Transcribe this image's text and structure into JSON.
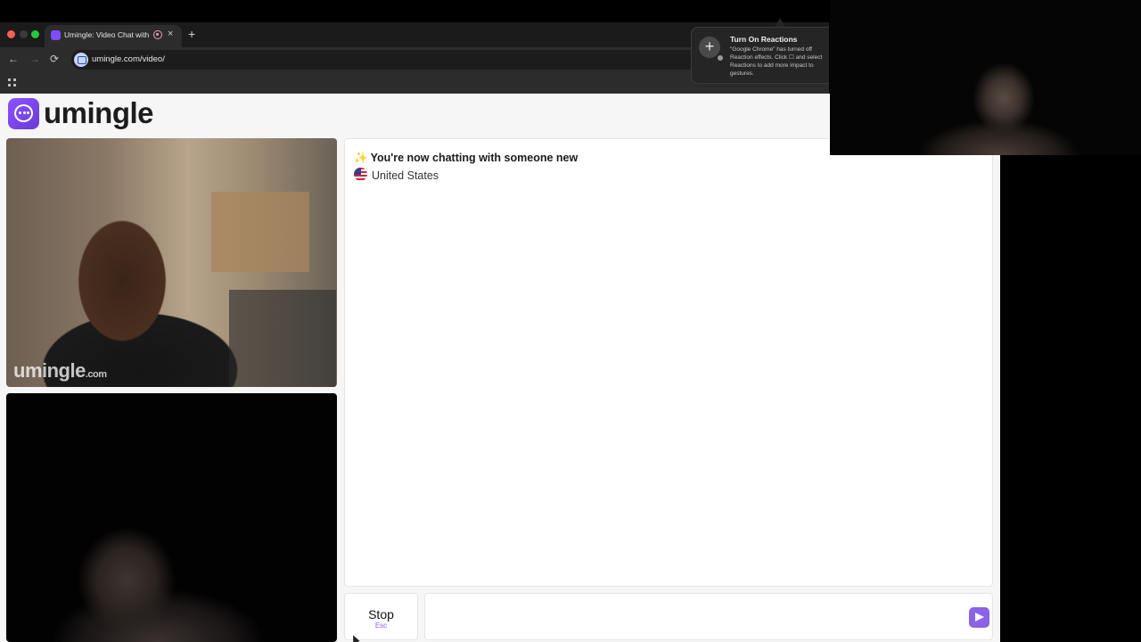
{
  "browser": {
    "tab_title": "Umingle: Video Chat with",
    "tab_close": "×",
    "new_tab": "+",
    "url": "umingle.com/video/",
    "back": "←",
    "forward": "→",
    "reload": "⟳"
  },
  "reactions_popup": {
    "title": "Turn On Reactions",
    "body": "\"Google Chrome\" has turned off Reaction effects. Click ☐ and select Reactions to add more impact to gestures.",
    "plus": "+"
  },
  "site": {
    "logo_text": "umingle",
    "watermark": "umingle",
    "watermark_suffix": ".com"
  },
  "chat": {
    "status_icon": "✨",
    "status": "You're now chatting with someone new",
    "country": "United States"
  },
  "controls": {
    "stop_label": "Stop",
    "stop_hint": "Esc",
    "message_placeholder": ""
  },
  "colors": {
    "accent": "#8a63e6",
    "page_bg": "#f6f6f7"
  }
}
